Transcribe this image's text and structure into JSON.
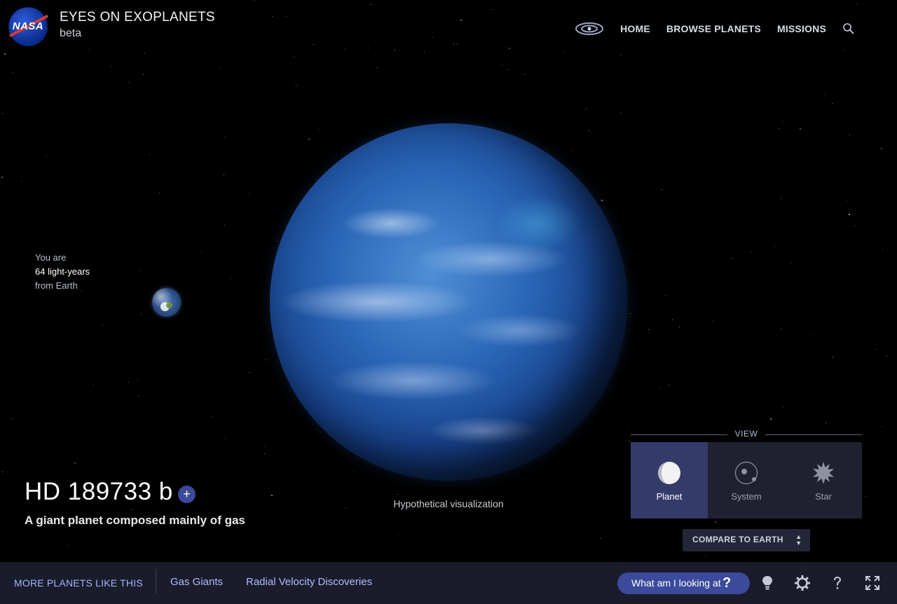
{
  "header": {
    "logo_text": "NASA",
    "title": "EYES ON EXOPLANETS",
    "subtitle": "beta",
    "nav": {
      "home": "HOME",
      "browse": "BROWSE PLANETS",
      "missions": "MISSIONS"
    }
  },
  "distance": {
    "line1": "You are",
    "line2": "64 light-years",
    "line3": "from Earth"
  },
  "planet": {
    "name": "HD 189733 b",
    "add_label": "+",
    "description": "A giant planet composed mainly of gas",
    "visualization_note": "Hypothetical visualization"
  },
  "view": {
    "label": "VIEW",
    "options": [
      {
        "label": "Planet",
        "icon": "planet-icon",
        "active": true
      },
      {
        "label": "System",
        "icon": "system-icon",
        "active": false
      },
      {
        "label": "Star",
        "icon": "star-icon",
        "active": false
      }
    ],
    "compare": "COMPARE TO EARTH",
    "compare_arrows": "▲\n▼"
  },
  "bottom": {
    "more_label": "MORE PLANETS LIKE THIS",
    "tags": [
      "Gas Giants",
      "Radial Velocity Discoveries"
    ],
    "what_label": "What am I looking at",
    "what_q": "?"
  },
  "colors": {
    "accent": "#3b4a9b",
    "panel": "#1f2131",
    "bottom_bar": "#1a1c2b",
    "link": "#aebeff"
  }
}
